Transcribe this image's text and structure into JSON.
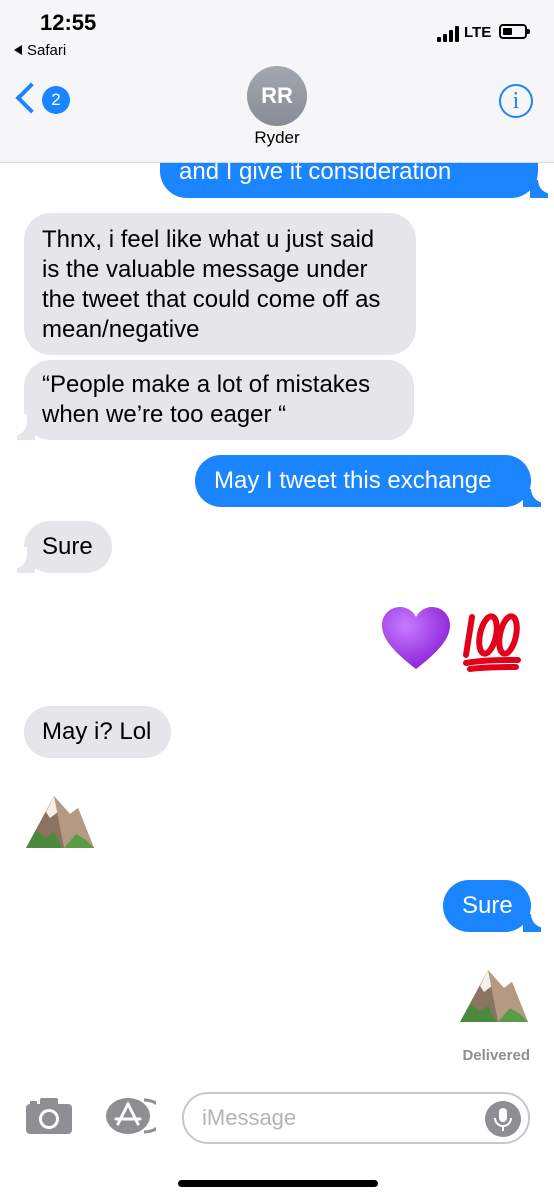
{
  "status_bar": {
    "time": "12:55",
    "back_app": "Safari",
    "network": "LTE"
  },
  "header": {
    "back_count": "2",
    "avatar_initials": "RR",
    "contact_name": "Ryder",
    "info_glyph": "i"
  },
  "messages": [
    {
      "sender": "me",
      "text": "and I give it consideration"
    },
    {
      "sender": "them",
      "text": "Thnx, i feel like what u just said is the valuable message under the tweet that could come off as mean/negative"
    },
    {
      "sender": "them",
      "text": "“People make a lot of mistakes when we’re too eager “"
    },
    {
      "sender": "me",
      "text": "May I tweet this exchange"
    },
    {
      "sender": "them",
      "text": "Sure"
    },
    {
      "sender": "me",
      "emoji": [
        "purple-heart",
        "hundred-points"
      ]
    },
    {
      "sender": "them",
      "text": "May i? Lol"
    },
    {
      "sender": "them",
      "emoji": [
        "snow-capped-mountain"
      ]
    },
    {
      "sender": "me",
      "text": "Sure"
    },
    {
      "sender": "me",
      "emoji": [
        "snow-capped-mountain"
      ]
    }
  ],
  "receipt": "Delivered",
  "input": {
    "placeholder": "iMessage"
  },
  "colors": {
    "sent_bubble": "#1a85ff",
    "received_bubble": "#e5e5ea",
    "accent": "#1a85ff"
  }
}
